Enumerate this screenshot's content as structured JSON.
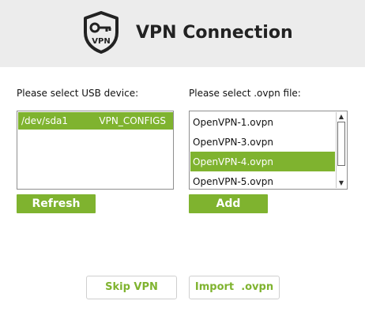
{
  "header": {
    "title": "VPN Connection",
    "logo_icon": "shield-key-vpn-icon",
    "logo_text": "VPN"
  },
  "usb": {
    "label": "Please select USB device:",
    "devices": [
      {
        "path": "/dev/sda1",
        "name": "VPN_CONFIGS",
        "selected": true
      }
    ],
    "refresh_label": "Refresh"
  },
  "ovpn": {
    "label": "Please select .ovpn file:",
    "files": [
      "OpenVPN-1.ovpn",
      "OpenVPN-3.ovpn",
      "OpenVPN-4.ovpn",
      "OpenVPN-5.ovpn"
    ],
    "selected_file": "OpenVPN-4.ovpn",
    "add_label": "Add"
  },
  "footer": {
    "skip_label": "Skip VPN",
    "import_label": "Import  .ovpn"
  },
  "colors": {
    "accent": "#7fb32f",
    "header_bg": "#ececec",
    "text": "#222222"
  }
}
